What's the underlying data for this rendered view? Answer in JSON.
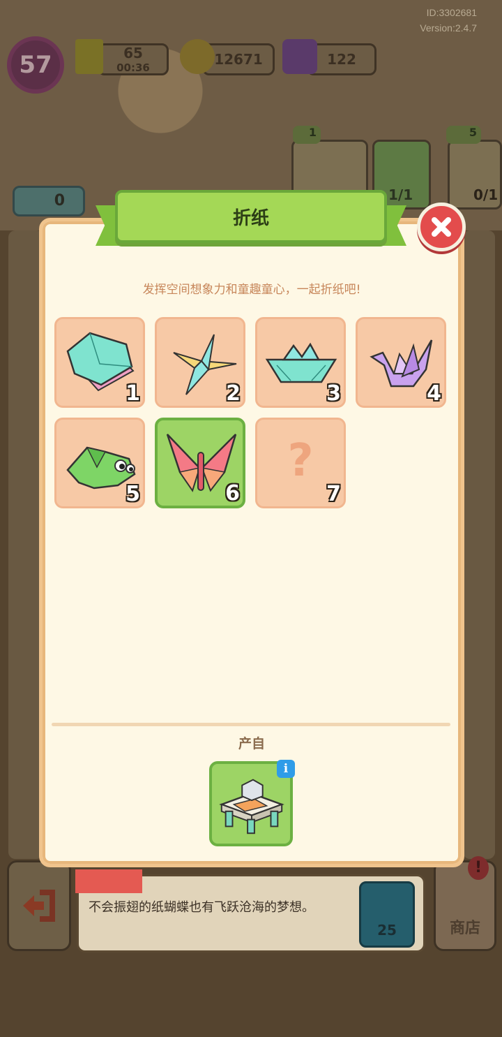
{
  "header": {
    "user_id": "ID:3302681",
    "version": "Version:2.4.7",
    "level": "57",
    "energy": "65",
    "energy_timer": "00:36",
    "coins": "12671",
    "gems": "122"
  },
  "background": {
    "pet_counter": "0",
    "tool1_stars": "1",
    "tool1_progress": "1/1",
    "tool2_stars": "5",
    "tool2_progress": "0/1",
    "description": "不会振翅的纸蝴蝶也有飞跃沧海的梦想。",
    "sell_price": "25",
    "shop_label": "商店",
    "shop_alert": "!"
  },
  "modal": {
    "title": "折纸",
    "subtitle": "发挥空间想象力和童趣童心，一起折纸吧!",
    "items": [
      {
        "num": "1",
        "name": "paper-flower"
      },
      {
        "num": "2",
        "name": "paper-shuriken"
      },
      {
        "num": "3",
        "name": "paper-boat"
      },
      {
        "num": "4",
        "name": "paper-crane"
      },
      {
        "num": "5",
        "name": "paper-frog"
      },
      {
        "num": "6",
        "name": "paper-butterfly"
      },
      {
        "num": "7",
        "name": "unknown"
      }
    ],
    "unknown_glyph": "?",
    "selected_item": "6",
    "source_label": "产自",
    "info_glyph": "i"
  },
  "colors": {
    "panel": "#fef8e5",
    "tile": "#f7c9a6",
    "tile_selected": "#9dd465",
    "ribbon": "#a4d856",
    "close": "#e34c4c",
    "info": "#2f9ce8"
  }
}
